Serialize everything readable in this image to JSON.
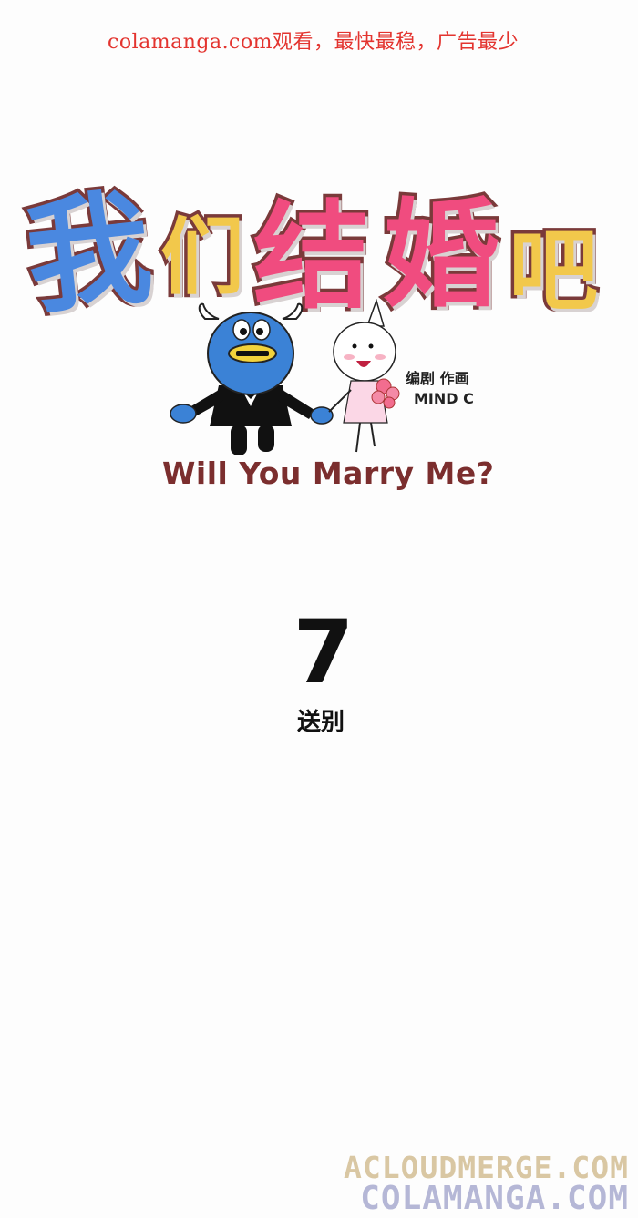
{
  "banner": "colamanga.com观看，最快最稳，广告最少",
  "title": [
    "我",
    "们",
    "结",
    "婚",
    "吧"
  ],
  "credits": {
    "role": "编剧 作画",
    "author": "MIND C"
  },
  "subtitle": "Will You Marry Me?",
  "chapter": {
    "number": "7",
    "title": "送别"
  },
  "watermarks": [
    "ACLOUDMERGE.COM",
    "COLAMANGA.COM"
  ],
  "colors": {
    "blue": "#4a88e0",
    "pink": "#f04c7f",
    "yellow": "#f2c84b",
    "outline": "#7a3a3a",
    "banner": "#e3342f"
  }
}
